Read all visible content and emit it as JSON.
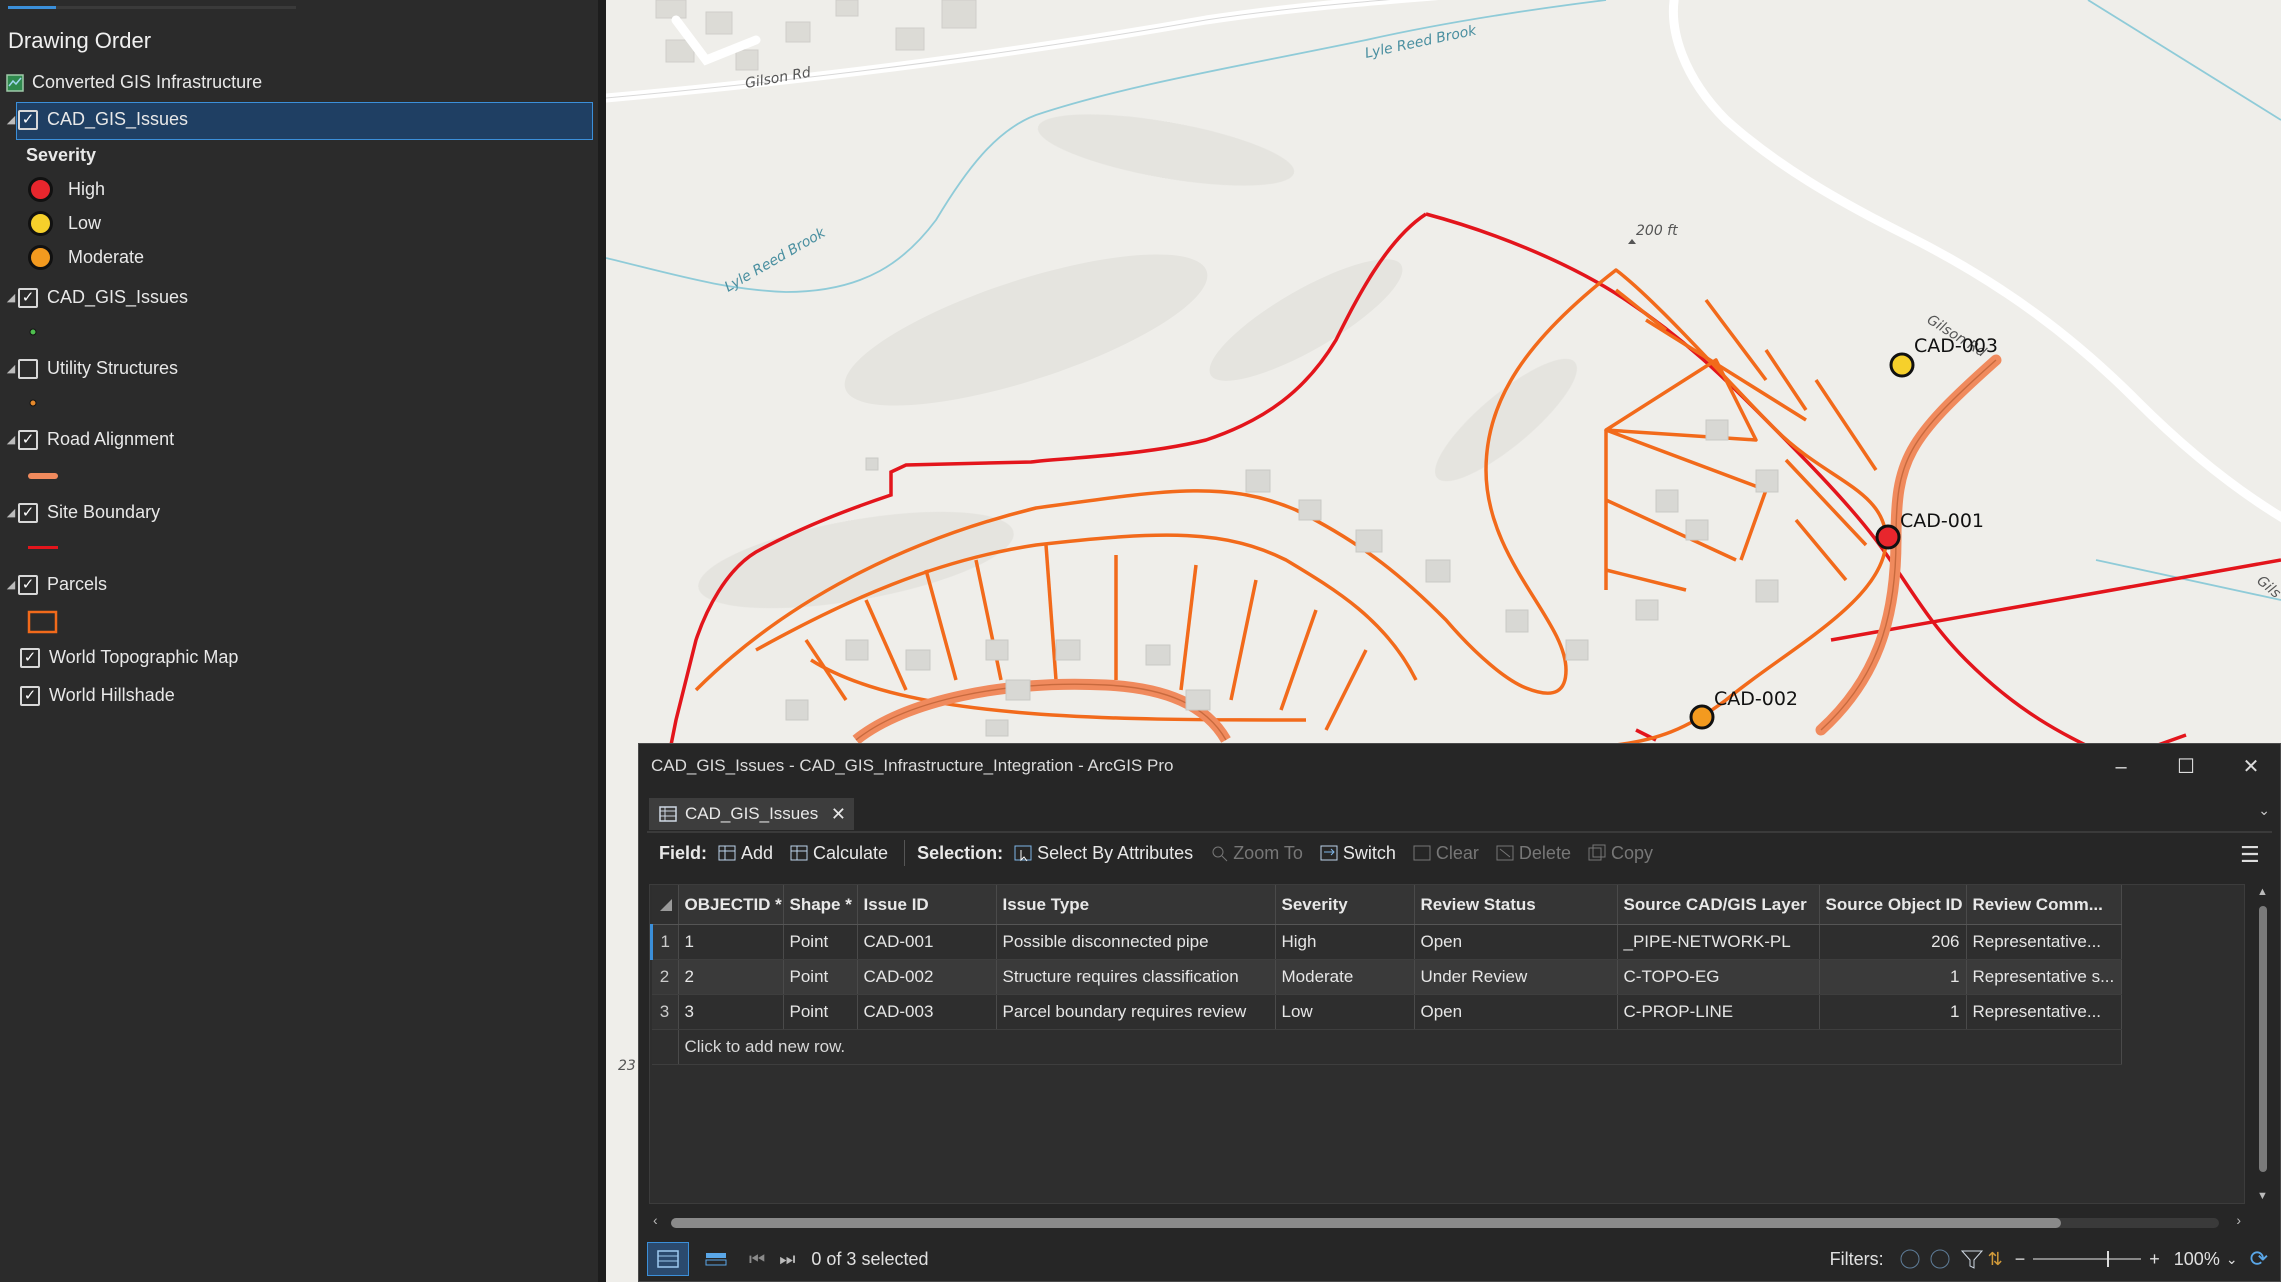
{
  "contents": {
    "title": "Drawing Order",
    "layers": [
      {
        "label": "Converted GIS Infrastructure",
        "checked": null
      },
      {
        "label": "CAD_GIS_Issues",
        "checked": true
      },
      {
        "label": "CAD_GIS_Issues",
        "checked": true
      },
      {
        "label": "Utility Structures",
        "checked": false
      },
      {
        "label": "Road Alignment",
        "checked": true
      },
      {
        "label": "Site Boundary",
        "checked": true
      },
      {
        "label": "Parcels",
        "checked": true
      },
      {
        "label": "World Topographic Map",
        "checked": true
      },
      {
        "label": "World Hillshade",
        "checked": true
      }
    ],
    "legend": {
      "header": "Severity",
      "items": [
        {
          "label": "High",
          "color": "#e8262d"
        },
        {
          "label": "Low",
          "color": "#f6d02b"
        },
        {
          "label": "Moderate",
          "color": "#f39a1f"
        }
      ]
    }
  },
  "map": {
    "labels": {
      "road1": "Gilson Rd",
      "brook1": "Lyle Reed Brook",
      "brook2": "Lyle Reed Brook",
      "elev": "200 ft",
      "road2": "Gilson Rd",
      "road3": "Gils",
      "elev2": "23"
    },
    "points": [
      {
        "id": "CAD-001",
        "color": "#e8262d"
      },
      {
        "id": "CAD-002",
        "color": "#f39a1f"
      },
      {
        "id": "CAD-003",
        "color": "#f6d02b"
      }
    ],
    "colors": {
      "boundary": "#e3151c",
      "parcels": "#f26a1b",
      "road": "#f08a5d",
      "water": "#8fcbd8"
    }
  },
  "table_window": {
    "title": "CAD_GIS_Issues - CAD_GIS_Infrastructure_Integration - ArcGIS Pro",
    "tab_label": "CAD_GIS_Issues",
    "toolbar": {
      "field_label": "Field:",
      "add": "Add",
      "calculate": "Calculate",
      "selection_label": "Selection:",
      "select_by_attributes": "Select By Attributes",
      "zoom_to": "Zoom To",
      "switch": "Switch",
      "clear": "Clear",
      "delete": "Delete",
      "copy": "Copy"
    },
    "columns": [
      "OBJECTID *",
      "Shape *",
      "Issue ID",
      "Issue Type",
      "Severity",
      "Review Status",
      "Source CAD/GIS Layer",
      "Source Object ID",
      "Review Comm..."
    ],
    "rows": [
      {
        "n": "1",
        "objectid": "1",
        "shape": "Point",
        "issue_id": "CAD-001",
        "issue_type": "Possible disconnected pipe",
        "severity": "High",
        "status": "Open",
        "layer": "_PIPE-NETWORK-PL",
        "src_id": "206",
        "comment": "Representative..."
      },
      {
        "n": "2",
        "objectid": "2",
        "shape": "Point",
        "issue_id": "CAD-002",
        "issue_type": "Structure requires classification",
        "severity": "Moderate",
        "status": "Under Review",
        "layer": "C-TOPO-EG",
        "src_id": "1",
        "comment": "Representative s..."
      },
      {
        "n": "3",
        "objectid": "3",
        "shape": "Point",
        "issue_id": "CAD-003",
        "issue_type": "Parcel boundary requires review",
        "severity": "Low",
        "status": "Open",
        "layer": "C-PROP-LINE",
        "src_id": "1",
        "comment": "Representative..."
      }
    ],
    "add_row_text": "Click to add new row.",
    "status": {
      "selected": "0 of 3 selected",
      "filters_label": "Filters:",
      "zoom": "100%"
    }
  }
}
